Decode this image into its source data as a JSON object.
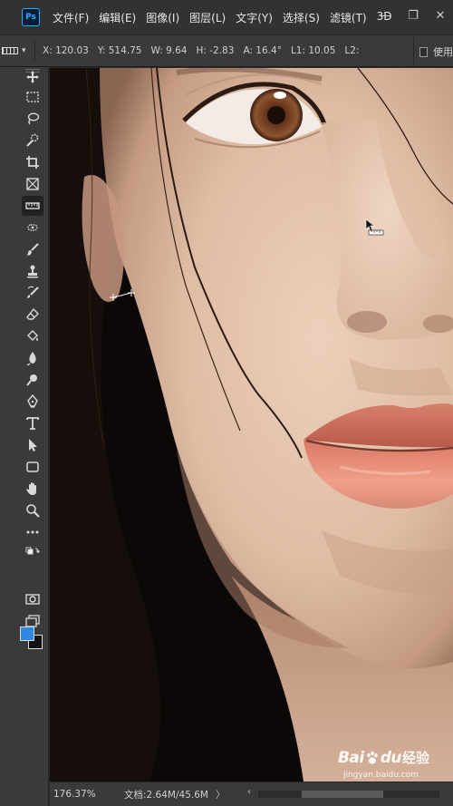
{
  "app": {
    "logo_text": "Ps"
  },
  "menu": [
    "文件(F)",
    "编辑(E)",
    "图像(I)",
    "图层(L)",
    "文字(Y)",
    "选择(S)",
    "滤镜(T)",
    "3D"
  ],
  "window_controls": {
    "minimize": "—",
    "restore": "❐",
    "close": "✕"
  },
  "options_bar": {
    "x": "X: 120.03",
    "y": "Y: 514.75",
    "w": "W: 9.64",
    "h": "H: -2.83",
    "a": "A: 16.4°",
    "l1": "L1: 10.05",
    "l2": "L2:",
    "use_label": "使用"
  },
  "toolbar": {
    "tools": [
      "move-tool",
      "marquee-tool",
      "lasso-tool",
      "quick-selection-tool",
      "crop-tool",
      "frame-tool",
      "ruler-tool",
      "spot-healing-tool",
      "brush-tool",
      "clone-stamp-tool",
      "history-brush-tool",
      "eraser-tool",
      "paint-bucket-tool",
      "blur-tool",
      "dodge-tool",
      "pen-tool",
      "type-tool",
      "path-selection-tool",
      "rectangle-tool",
      "hand-tool",
      "zoom-tool",
      "more-tools",
      "quick-mask",
      "screen-mode"
    ],
    "active_tool": "ruler-tool",
    "colors": {
      "foreground": "#2e88e6",
      "background": "#111111"
    }
  },
  "status": {
    "zoom": "176.37%",
    "doc": "文档:2.64M/45.6M",
    "arrow": "〉",
    "scroll_left": "‹"
  },
  "watermark": {
    "brand": "Bai",
    "brand2": "du",
    "product": "经验",
    "url": "jingyan.baidu.com"
  },
  "colors": {
    "app_bg": "#323232",
    "panel": "#3a3a3a",
    "accent": "#31a8ff"
  }
}
